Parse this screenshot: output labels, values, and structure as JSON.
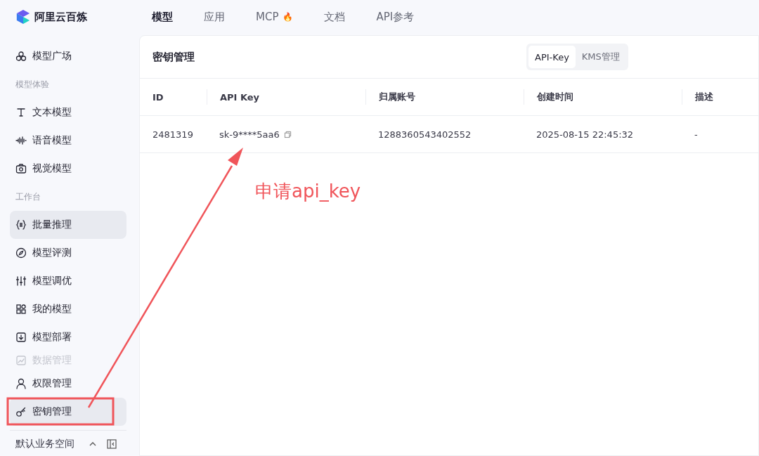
{
  "brand": {
    "name": "阿里云百炼"
  },
  "nav": [
    {
      "label": "模型",
      "selected": true
    },
    {
      "label": "应用",
      "selected": false
    },
    {
      "label": "MCP",
      "selected": false,
      "badge": "🔥"
    },
    {
      "label": "文档",
      "selected": false
    },
    {
      "label": "API参考",
      "selected": false
    }
  ],
  "sidebar": {
    "items": [
      {
        "kind": "item",
        "label": "模型广场",
        "selected": false,
        "disabled": false
      },
      {
        "kind": "header",
        "label": "模型体验"
      },
      {
        "kind": "item",
        "label": "文本模型",
        "selected": false,
        "disabled": false
      },
      {
        "kind": "item",
        "label": "语音模型",
        "selected": false,
        "disabled": false
      },
      {
        "kind": "item",
        "label": "视觉模型",
        "selected": false,
        "disabled": false
      },
      {
        "kind": "header",
        "label": "工作台"
      },
      {
        "kind": "item",
        "label": "批量推理",
        "selected": true,
        "disabled": false
      },
      {
        "kind": "item",
        "label": "模型评测",
        "selected": false,
        "disabled": false
      },
      {
        "kind": "item",
        "label": "模型调优",
        "selected": false,
        "disabled": false
      },
      {
        "kind": "item",
        "label": "我的模型",
        "selected": false,
        "disabled": false
      },
      {
        "kind": "item",
        "label": "模型部署",
        "selected": false,
        "disabled": false
      },
      {
        "kind": "item",
        "label": "数据管理",
        "selected": false,
        "disabled": true
      },
      {
        "kind": "item",
        "label": "权限管理",
        "selected": false,
        "disabled": false
      },
      {
        "kind": "item",
        "label": "密钥管理",
        "selected": true,
        "disabled": false
      }
    ],
    "workspace": "默认业务空间"
  },
  "panel": {
    "title": "密钥管理",
    "tabs": [
      {
        "label": "API-Key",
        "selected": true
      },
      {
        "label": "KMS管理",
        "selected": false
      }
    ]
  },
  "table": {
    "columns": [
      "ID",
      "API Key",
      "归属账号",
      "创建时间",
      "描述"
    ],
    "rows": [
      {
        "id": "2481319",
        "api_key": "sk-9****5aa6",
        "account": "1288360543402552",
        "created": "2025-08-15 22:45:32",
        "description": "-"
      }
    ]
  },
  "annotation": {
    "text": "申请api_key"
  }
}
